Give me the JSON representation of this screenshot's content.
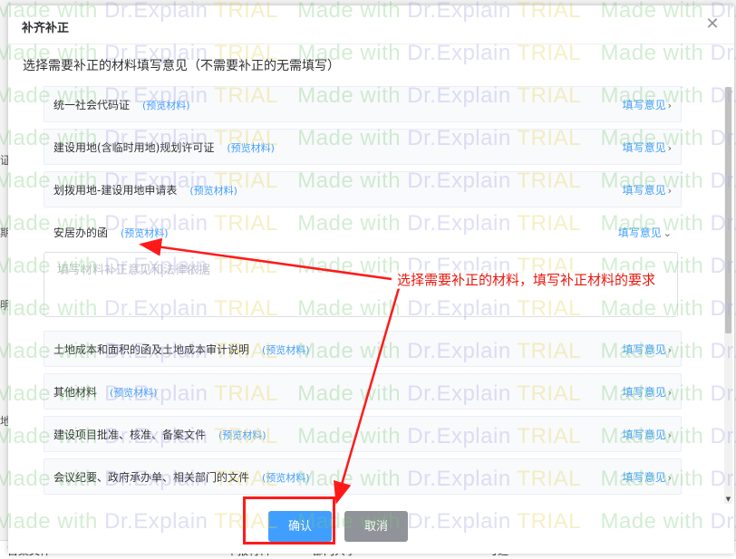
{
  "background": {
    "bottom_row": [
      "首案文件",
      "申报材料",
      "部门共享",
      "0",
      "可选",
      "0"
    ],
    "left_fragments": [
      "证",
      "期",
      "明",
      "地"
    ]
  },
  "dialog": {
    "title": "补齐补正",
    "close_icon": "close-icon",
    "subtitle": "选择需要补正的材料填写意见（不需要补正的无需填写）",
    "items": [
      {
        "name": "统一社会代码证",
        "preview": "(预览材料)",
        "action": "填写意见",
        "chevron": "›"
      },
      {
        "name": "建设用地(含临时用地)规划许可证",
        "preview": "(预览材料)",
        "action": "填写意见",
        "chevron": "›"
      },
      {
        "name": "划拨用地-建设用地申请表",
        "preview": "(预览材料)",
        "action": "填写意见",
        "chevron": "›"
      },
      {
        "name": "安居办的函",
        "preview": "(预览材料)",
        "action": "填写意见",
        "chevron": "⌄"
      },
      {
        "name": "土地成本和面积的函及土地成本审计说明",
        "preview": "(预览材料)",
        "action": "填写意见",
        "chevron": "›"
      },
      {
        "name": "其他材料",
        "preview": "(预览材料)",
        "action": "填写意见",
        "chevron": "›"
      },
      {
        "name": "建设项目批准、核准、备案文件",
        "preview": "(预览材料)",
        "action": "填写意见",
        "chevron": "›"
      },
      {
        "name": "会议纪要、政府承办单、相关部门的文件",
        "preview": "(预览材料)",
        "action": "填写意见",
        "chevron": "›"
      }
    ],
    "opinion_placeholder": "填写材料补正意见和法律依据",
    "opinion_value": "",
    "confirm_label": "确认",
    "cancel_label": "取消"
  },
  "annotation": {
    "text": "选择需要补正的材料，填写补正材料的要求",
    "color": "#e8180e"
  },
  "watermark": {
    "made": "Made with ",
    "brand": "Dr.Explain ",
    "trial": "TRIAL"
  },
  "colors": {
    "accent": "#409eff",
    "cancel": "#909399",
    "annotation": "#ff1a1a"
  }
}
